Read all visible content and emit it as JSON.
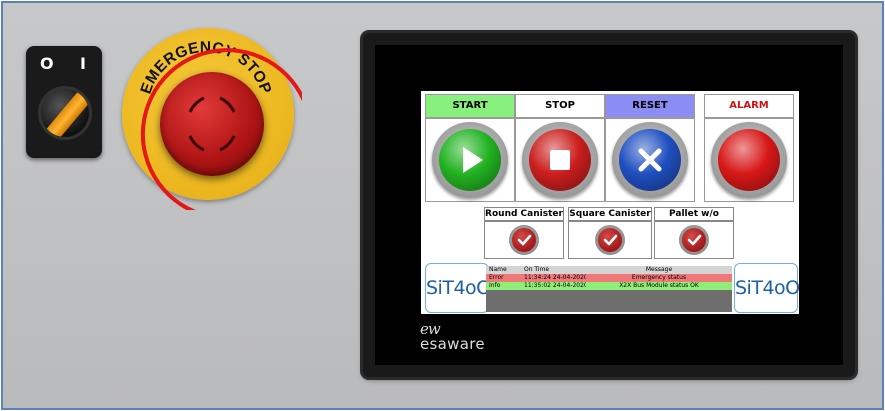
{
  "selector_switch": {
    "left_label": "O",
    "right_label": "I"
  },
  "emergency_stop": {
    "label": "EMERGENCY STOP"
  },
  "hmi": {
    "controls": [
      {
        "id": "start",
        "label": "START",
        "header_color": "#88f07c",
        "label_color": "#000000",
        "button_color": "#22b322",
        "icon": "play-icon"
      },
      {
        "id": "stop",
        "label": "STOP",
        "header_color": "#ffffff",
        "label_color": "#000000",
        "button_color": "#cc1e1e",
        "icon": "stop-icon"
      },
      {
        "id": "reset",
        "label": "RESET",
        "header_color": "#8c8cf5",
        "label_color": "#000000",
        "button_color": "#1f4fc0",
        "icon": "x-icon"
      },
      {
        "id": "alarm",
        "label": "ALARM",
        "header_color": "#ffffff",
        "label_color": "#d61010",
        "button_color": "#d81818",
        "icon": "lamp"
      }
    ],
    "sensors": [
      {
        "label": "Round Canister",
        "icon": "check-icon"
      },
      {
        "label": "Square Canister",
        "icon": "check-icon"
      },
      {
        "label": "Pallet w/o Canister",
        "icon": "check-icon"
      }
    ],
    "logo_text": "SiT4oO",
    "log": {
      "columns": [
        "Name",
        "On Time",
        "Message"
      ],
      "rows": [
        {
          "name": "Error",
          "time": "11:34:24 24-04-2020",
          "message": "Emergency status",
          "color": "#f07878"
        },
        {
          "name": "Info",
          "time": "11:35:02 24-04-2020",
          "message": "X2X Bus Module status OK",
          "color": "#90ee78"
        }
      ]
    },
    "brand": {
      "mark": "ew",
      "name": "esaware"
    }
  }
}
